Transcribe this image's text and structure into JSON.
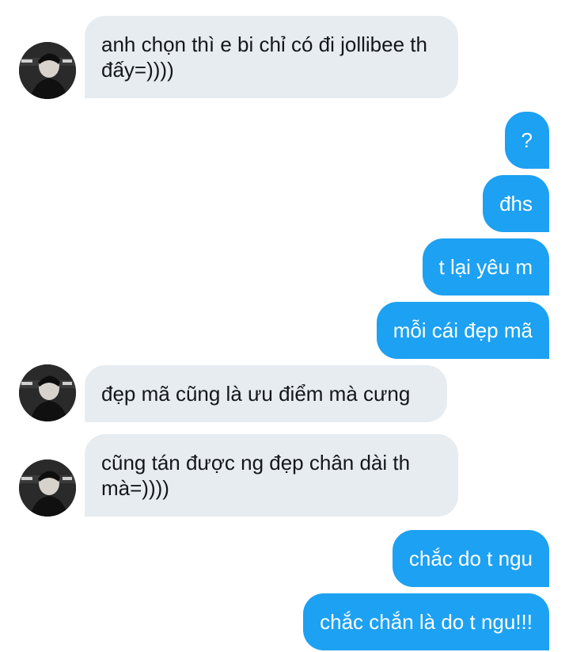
{
  "conversation": {
    "messages": [
      {
        "sender": "other",
        "text": "anh chọn thì e bi chỉ có đi jollibee th đấy=))))"
      },
      {
        "sender": "me",
        "text": "?"
      },
      {
        "sender": "me",
        "text": "đhs"
      },
      {
        "sender": "me",
        "text": "t lại yêu m"
      },
      {
        "sender": "me",
        "text": "mỗi cái đẹp mã"
      },
      {
        "sender": "other",
        "text": "đẹp mã cũng là ưu điểm mà cưng"
      },
      {
        "sender": "other",
        "text": "cũng tán được ng đẹp chân dài th mà=))))"
      },
      {
        "sender": "me",
        "text": "chắc do t ngu"
      },
      {
        "sender": "me",
        "text": "chắc chắn là do t ngu!!!"
      }
    ]
  },
  "colors": {
    "incoming_bubble": "#e6ecf0",
    "outgoing_bubble": "#1da1f2",
    "incoming_text": "#14171a",
    "outgoing_text": "#ffffff"
  },
  "icons": {
    "avatar": "contact-avatar-photo"
  }
}
